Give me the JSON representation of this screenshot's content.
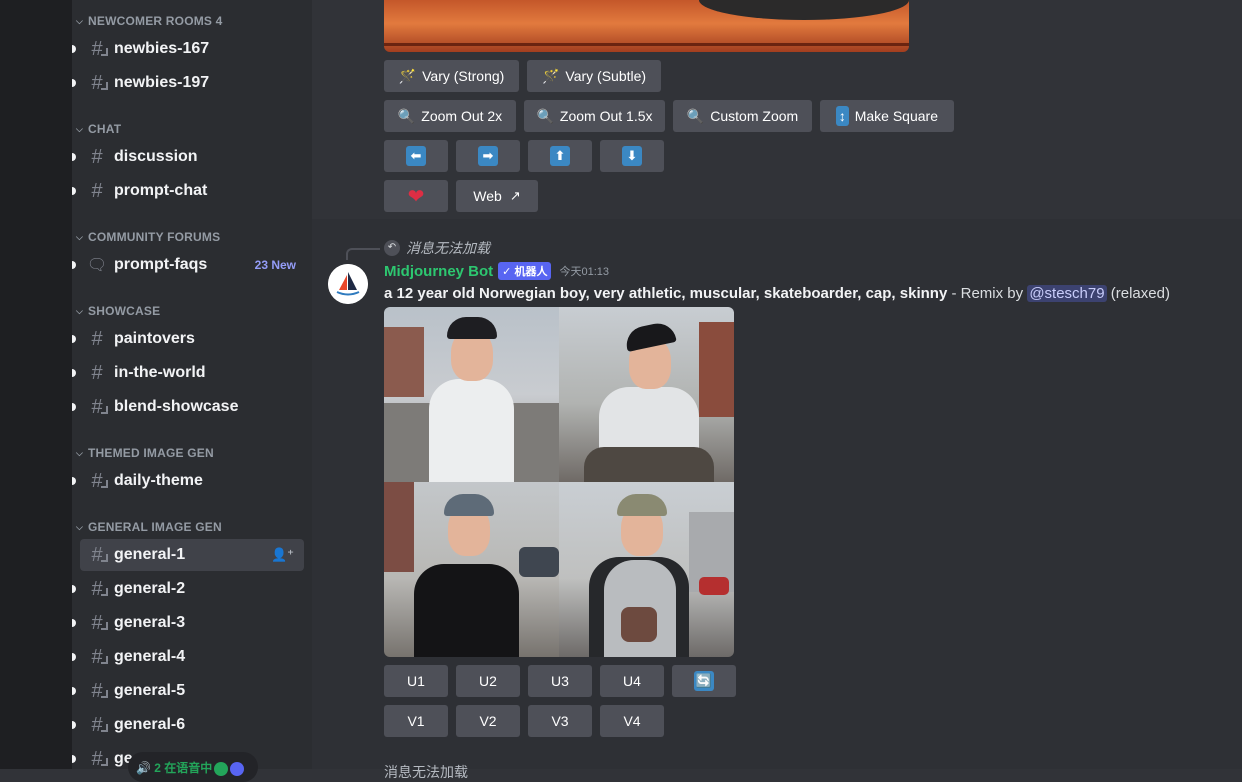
{
  "sidebar": {
    "categories": [
      {
        "label": "NEWCOMER ROOMS 4"
      },
      {
        "label": "CHAT"
      },
      {
        "label": "COMMUNITY FORUMS"
      },
      {
        "label": "SHOWCASE"
      },
      {
        "label": "THEMED IMAGE GEN"
      },
      {
        "label": "GENERAL IMAGE GEN"
      }
    ],
    "channels": [
      {
        "name": "newbies-167"
      },
      {
        "name": "newbies-197"
      },
      {
        "name": "discussion"
      },
      {
        "name": "prompt-chat"
      },
      {
        "name": "prompt-faqs",
        "badge": "23 New"
      },
      {
        "name": "paintovers"
      },
      {
        "name": "in-the-world"
      },
      {
        "name": "blend-showcase"
      },
      {
        "name": "daily-theme"
      },
      {
        "name": "general-1"
      },
      {
        "name": "general-2"
      },
      {
        "name": "general-3"
      },
      {
        "name": "general-4"
      },
      {
        "name": "general-5"
      },
      {
        "name": "general-6"
      },
      {
        "name": "ge"
      }
    ],
    "voice_status": "2 在语音中"
  },
  "previous_message": {
    "buttons": {
      "vary_strong": "Vary (Strong)",
      "vary_subtle": "Vary (Subtle)",
      "zoom_out_2x": "Zoom Out 2x",
      "zoom_out_15x": "Zoom Out 1.5x",
      "custom_zoom": "Custom Zoom",
      "make_square": "Make Square",
      "web": "Web"
    },
    "icons": [
      "magic-wand-icon",
      "magnifier-icon",
      "up-down-arrow-icon",
      "arrow-left-icon",
      "arrow-right-icon",
      "arrow-up-icon",
      "arrow-down-icon",
      "heart-icon",
      "external-link-icon"
    ]
  },
  "message": {
    "reply_text": "消息无法加载",
    "author": "Midjourney Bot",
    "bot_tag": "✓ 机器人",
    "timestamp": "今天01:13",
    "prompt_bold": "a 12 year old Norwegian boy, very athletic, muscular, skateboarder, cap, skinny",
    "prompt_suffix": " - Remix by ",
    "mention": "@stesch79",
    "mode": " (relaxed)",
    "upscale_buttons": [
      "U1",
      "U2",
      "U3",
      "U4"
    ],
    "variation_buttons": [
      "V1",
      "V2",
      "V3",
      "V4"
    ]
  },
  "next_reply_text": "消息无法加载",
  "colors": {
    "accent_username": "#2dc770",
    "bot_badge": "#5865f2",
    "new_badge": "#949cf7"
  }
}
